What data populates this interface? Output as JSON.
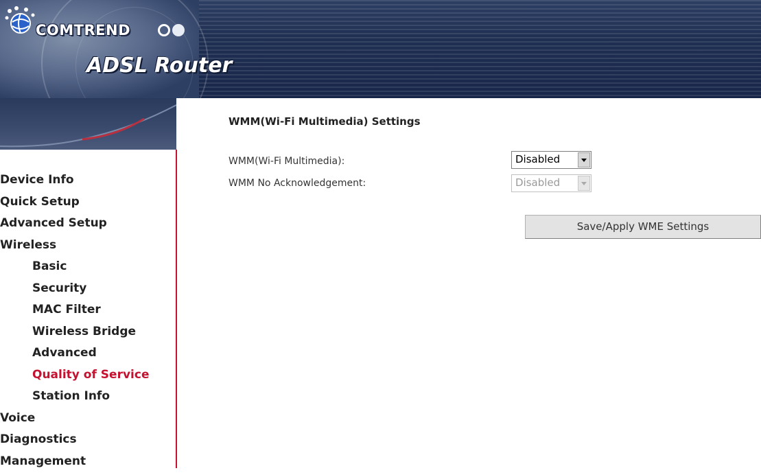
{
  "header": {
    "brand": "COMTREND",
    "product": "ADSL Router"
  },
  "sidebar": {
    "items": [
      {
        "label": "Device Info",
        "level": "top"
      },
      {
        "label": "Quick Setup",
        "level": "top"
      },
      {
        "label": "Advanced Setup",
        "level": "top"
      },
      {
        "label": "Wireless",
        "level": "top"
      },
      {
        "label": "Basic",
        "level": "sub"
      },
      {
        "label": "Security",
        "level": "sub"
      },
      {
        "label": "MAC Filter",
        "level": "sub"
      },
      {
        "label": "Wireless Bridge",
        "level": "sub"
      },
      {
        "label": "Advanced",
        "level": "sub"
      },
      {
        "label": "Quality of Service",
        "level": "sub",
        "active": true
      },
      {
        "label": "Station Info",
        "level": "sub"
      },
      {
        "label": "Voice",
        "level": "top"
      },
      {
        "label": "Diagnostics",
        "level": "top"
      },
      {
        "label": "Management",
        "level": "top"
      }
    ]
  },
  "main": {
    "title": "WMM(Wi-Fi Multimedia) Settings",
    "fields": [
      {
        "label": "WMM(Wi-Fi Multimedia):",
        "value": "Disabled",
        "enabled": true
      },
      {
        "label": "WMM No Acknowledgement:",
        "value": "Disabled",
        "enabled": false
      }
    ],
    "save_button": "Save/Apply WME Settings"
  },
  "colors": {
    "accent": "#c41230",
    "header_bg": "#1f2f52"
  }
}
